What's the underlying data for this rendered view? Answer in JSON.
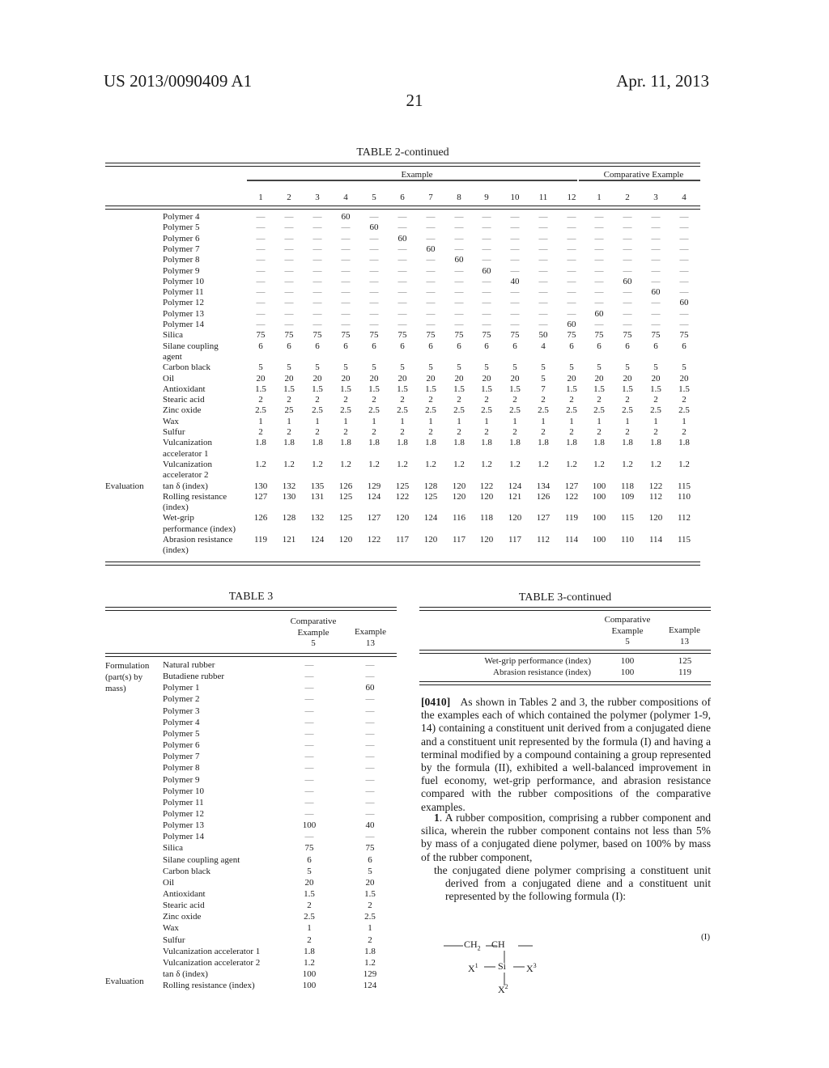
{
  "header": {
    "patent_number": "US 2013/0090409 A1",
    "date": "Apr. 11, 2013",
    "page_number": "21"
  },
  "table2": {
    "title": "TABLE 2-continued",
    "group_example": "Example",
    "group_comparative": "Comparative Example",
    "columns": [
      "1",
      "2",
      "3",
      "4",
      "5",
      "6",
      "7",
      "8",
      "9",
      "10",
      "11",
      "12",
      "1",
      "2",
      "3",
      "4"
    ],
    "evaluation_label": "Evaluation",
    "rows": [
      {
        "label": "Polymer 4",
        "values": [
          "—",
          "—",
          "—",
          "60",
          "—",
          "—",
          "—",
          "—",
          "—",
          "—",
          "—",
          "—",
          "—",
          "—",
          "—",
          "—"
        ]
      },
      {
        "label": "Polymer 5",
        "values": [
          "—",
          "—",
          "—",
          "—",
          "60",
          "—",
          "—",
          "—",
          "—",
          "—",
          "—",
          "—",
          "—",
          "—",
          "—",
          "—"
        ]
      },
      {
        "label": "Polymer 6",
        "values": [
          "—",
          "—",
          "—",
          "—",
          "—",
          "60",
          "—",
          "—",
          "—",
          "—",
          "—",
          "—",
          "—",
          "—",
          "—",
          "—"
        ]
      },
      {
        "label": "Polymer 7",
        "values": [
          "—",
          "—",
          "—",
          "—",
          "—",
          "—",
          "60",
          "—",
          "—",
          "—",
          "—",
          "—",
          "—",
          "—",
          "—",
          "—"
        ]
      },
      {
        "label": "Polymer 8",
        "values": [
          "—",
          "—",
          "—",
          "—",
          "—",
          "—",
          "—",
          "60",
          "—",
          "—",
          "—",
          "—",
          "—",
          "—",
          "—",
          "—"
        ]
      },
      {
        "label": "Polymer 9",
        "values": [
          "—",
          "—",
          "—",
          "—",
          "—",
          "—",
          "—",
          "—",
          "60",
          "—",
          "—",
          "—",
          "—",
          "—",
          "—",
          "—"
        ]
      },
      {
        "label": "Polymer 10",
        "values": [
          "—",
          "—",
          "—",
          "—",
          "—",
          "—",
          "—",
          "—",
          "—",
          "40",
          "—",
          "—",
          "—",
          "60",
          "—",
          "—"
        ]
      },
      {
        "label": "Polymer 11",
        "values": [
          "—",
          "—",
          "—",
          "—",
          "—",
          "—",
          "—",
          "—",
          "—",
          "—",
          "—",
          "—",
          "—",
          "—",
          "60",
          "—"
        ]
      },
      {
        "label": "Polymer 12",
        "values": [
          "—",
          "—",
          "—",
          "—",
          "—",
          "—",
          "—",
          "—",
          "—",
          "—",
          "—",
          "—",
          "—",
          "—",
          "—",
          "60"
        ]
      },
      {
        "label": "Polymer 13",
        "values": [
          "—",
          "—",
          "—",
          "—",
          "—",
          "—",
          "—",
          "—",
          "—",
          "—",
          "—",
          "—",
          "60",
          "—",
          "—",
          "—"
        ]
      },
      {
        "label": "Polymer 14",
        "values": [
          "—",
          "—",
          "—",
          "—",
          "—",
          "—",
          "—",
          "—",
          "—",
          "—",
          "—",
          "60",
          "—",
          "—",
          "—",
          "—"
        ]
      },
      {
        "label": "Silica",
        "values": [
          "75",
          "75",
          "75",
          "75",
          "75",
          "75",
          "75",
          "75",
          "75",
          "75",
          "50",
          "75",
          "75",
          "75",
          "75",
          "75"
        ]
      },
      {
        "label": "Silane coupling",
        "label2": "agent",
        "values": [
          "6",
          "6",
          "6",
          "6",
          "6",
          "6",
          "6",
          "6",
          "6",
          "6",
          "4",
          "6",
          "6",
          "6",
          "6",
          "6"
        ]
      },
      {
        "label": "Carbon black",
        "values": [
          "5",
          "5",
          "5",
          "5",
          "5",
          "5",
          "5",
          "5",
          "5",
          "5",
          "5",
          "5",
          "5",
          "5",
          "5",
          "5"
        ]
      },
      {
        "label": "Oil",
        "values": [
          "20",
          "20",
          "20",
          "20",
          "20",
          "20",
          "20",
          "20",
          "20",
          "20",
          "5",
          "20",
          "20",
          "20",
          "20",
          "20"
        ]
      },
      {
        "label": "Antioxidant",
        "values": [
          "1.5",
          "1.5",
          "1.5",
          "1.5",
          "1.5",
          "1.5",
          "1.5",
          "1.5",
          "1.5",
          "1.5",
          "7",
          "1.5",
          "1.5",
          "1.5",
          "1.5",
          "1.5"
        ]
      },
      {
        "label": "Stearic acid",
        "values": [
          "2",
          "2",
          "2",
          "2",
          "2",
          "2",
          "2",
          "2",
          "2",
          "2",
          "2",
          "2",
          "2",
          "2",
          "2",
          "2"
        ]
      },
      {
        "label": "Zinc oxide",
        "values": [
          "2.5",
          "25",
          "2.5",
          "2.5",
          "2.5",
          "2.5",
          "2.5",
          "2.5",
          "2.5",
          "2.5",
          "2.5",
          "2.5",
          "2.5",
          "2.5",
          "2.5",
          "2.5"
        ]
      },
      {
        "label": "Wax",
        "values": [
          "1",
          "1",
          "1",
          "1",
          "1",
          "1",
          "1",
          "1",
          "1",
          "1",
          "1",
          "1",
          "1",
          "1",
          "1",
          "1"
        ]
      },
      {
        "label": "Sulfur",
        "values": [
          "2",
          "2",
          "2",
          "2",
          "2",
          "2",
          "2",
          "2",
          "2",
          "2",
          "2",
          "2",
          "2",
          "2",
          "2",
          "2"
        ]
      },
      {
        "label": "Vulcanization",
        "label2": "accelerator 1",
        "values": [
          "1.8",
          "1.8",
          "1.8",
          "1.8",
          "1.8",
          "1.8",
          "1.8",
          "1.8",
          "1.8",
          "1.8",
          "1.8",
          "1.8",
          "1.8",
          "1.8",
          "1.8",
          "1.8"
        ]
      },
      {
        "label": "Vulcanization",
        "label2": "accelerator 2",
        "values": [
          "1.2",
          "1.2",
          "1.2",
          "1.2",
          "1.2",
          "1.2",
          "1.2",
          "1.2",
          "1.2",
          "1.2",
          "1.2",
          "1.2",
          "1.2",
          "1.2",
          "1.2",
          "1.2"
        ]
      },
      {
        "label": "tan δ (index)",
        "values": [
          "130",
          "132",
          "135",
          "126",
          "129",
          "125",
          "128",
          "120",
          "122",
          "124",
          "134",
          "127",
          "100",
          "118",
          "122",
          "115"
        ]
      },
      {
        "label": "Rolling resistance",
        "label2": "(index)",
        "values": [
          "127",
          "130",
          "131",
          "125",
          "124",
          "122",
          "125",
          "120",
          "120",
          "121",
          "126",
          "122",
          "100",
          "109",
          "112",
          "110"
        ]
      },
      {
        "label": "Wet-grip",
        "label2": "performance (index)",
        "values": [
          "126",
          "128",
          "132",
          "125",
          "127",
          "120",
          "124",
          "116",
          "118",
          "120",
          "127",
          "119",
          "100",
          "115",
          "120",
          "112"
        ]
      },
      {
        "label": "Abrasion resistance",
        "label2": "(index)",
        "values": [
          "119",
          "121",
          "124",
          "120",
          "122",
          "117",
          "120",
          "117",
          "120",
          "117",
          "112",
          "114",
          "100",
          "110",
          "114",
          "115"
        ]
      }
    ]
  },
  "table3": {
    "title": "TABLE 3",
    "col1_header": [
      "Comparative",
      "Example",
      "5"
    ],
    "col2_header": [
      "Example",
      "13"
    ],
    "group_formulation": [
      "Formulation",
      "(part(s) by",
      "mass)"
    ],
    "group_evaluation": "Evaluation",
    "rows": [
      {
        "label": "Natural rubber",
        "c5": "—",
        "e13": "—"
      },
      {
        "label": "Butadiene rubber",
        "c5": "—",
        "e13": "—"
      },
      {
        "label": "Polymer 1",
        "c5": "—",
        "e13": "60"
      },
      {
        "label": "Polymer 2",
        "c5": "—",
        "e13": "—"
      },
      {
        "label": "Polymer 3",
        "c5": "—",
        "e13": "—"
      },
      {
        "label": "Polymer 4",
        "c5": "—",
        "e13": "—"
      },
      {
        "label": "Polymer 5",
        "c5": "—",
        "e13": "—"
      },
      {
        "label": "Polymer 6",
        "c5": "—",
        "e13": "—"
      },
      {
        "label": "Polymer 7",
        "c5": "—",
        "e13": "—"
      },
      {
        "label": "Polymer 8",
        "c5": "—",
        "e13": "—"
      },
      {
        "label": "Polymer 9",
        "c5": "—",
        "e13": "—"
      },
      {
        "label": "Polymer 10",
        "c5": "—",
        "e13": "—"
      },
      {
        "label": "Polymer 11",
        "c5": "—",
        "e13": "—"
      },
      {
        "label": "Polymer 12",
        "c5": "—",
        "e13": "—"
      },
      {
        "label": "Polymer 13",
        "c5": "100",
        "e13": "40"
      },
      {
        "label": "Polymer 14",
        "c5": "—",
        "e13": "—"
      },
      {
        "label": "Silica",
        "c5": "75",
        "e13": "75"
      },
      {
        "label": "Silane coupling agent",
        "c5": "6",
        "e13": "6"
      },
      {
        "label": "Carbon black",
        "c5": "5",
        "e13": "5"
      },
      {
        "label": "Oil",
        "c5": "20",
        "e13": "20"
      },
      {
        "label": "Antioxidant",
        "c5": "1.5",
        "e13": "1.5"
      },
      {
        "label": "Stearic acid",
        "c5": "2",
        "e13": "2"
      },
      {
        "label": "Zinc oxide",
        "c5": "2.5",
        "e13": "2.5"
      },
      {
        "label": "Wax",
        "c5": "1",
        "e13": "1"
      },
      {
        "label": "Sulfur",
        "c5": "2",
        "e13": "2"
      },
      {
        "label": "Vulcanization accelerator 1",
        "c5": "1.8",
        "e13": "1.8"
      },
      {
        "label": "Vulcanization accelerator 2",
        "c5": "1.2",
        "e13": "1.2"
      },
      {
        "label": "tan δ (index)",
        "c5": "100",
        "e13": "129"
      },
      {
        "label": "Rolling resistance (index)",
        "c5": "100",
        "e13": "124"
      }
    ]
  },
  "table3_cont": {
    "title": "TABLE 3-continued",
    "col1_header": [
      "Comparative",
      "Example",
      "5"
    ],
    "col2_header": [
      "Example",
      "13"
    ],
    "rows": [
      {
        "label": "Wet-grip performance (index)",
        "c5": "100",
        "e13": "125"
      },
      {
        "label": "Abrasion resistance (index)",
        "c5": "100",
        "e13": "119"
      }
    ]
  },
  "paragraph_0410": {
    "tag": "[0410]",
    "text": "As shown in Tables 2 and 3, the rubber compositions of the examples each of which contained the polymer (polymer 1-9, 14) containing a constituent unit derived from a conjugated diene and a constituent unit represented by the formula (I) and having a terminal modified by a compound containing a group represented by the formula (II), exhibited a well-balanced improvement in fuel economy, wet-grip performance, and abrasion resistance compared with the rubber compositions of the comparative examples."
  },
  "claim1": {
    "number": "1",
    "text": ". A rubber composition, comprising a rubber component and silica, wherein the rubber component contains not less than 5% by mass of a conjugated diene polymer, based on 100% by mass of the rubber component,",
    "sub": "the conjugated diene polymer comprising a constituent unit derived from a conjugated diene and a constituent unit represented by the following formula (I):"
  },
  "formula": {
    "label": "(I)",
    "ch2": "CH",
    "ch2_sub": "2",
    "ch": "CH",
    "si": "Si",
    "x": "X",
    "x1_sup": "1",
    "x2_sup": "2",
    "x3_sup": "3"
  }
}
